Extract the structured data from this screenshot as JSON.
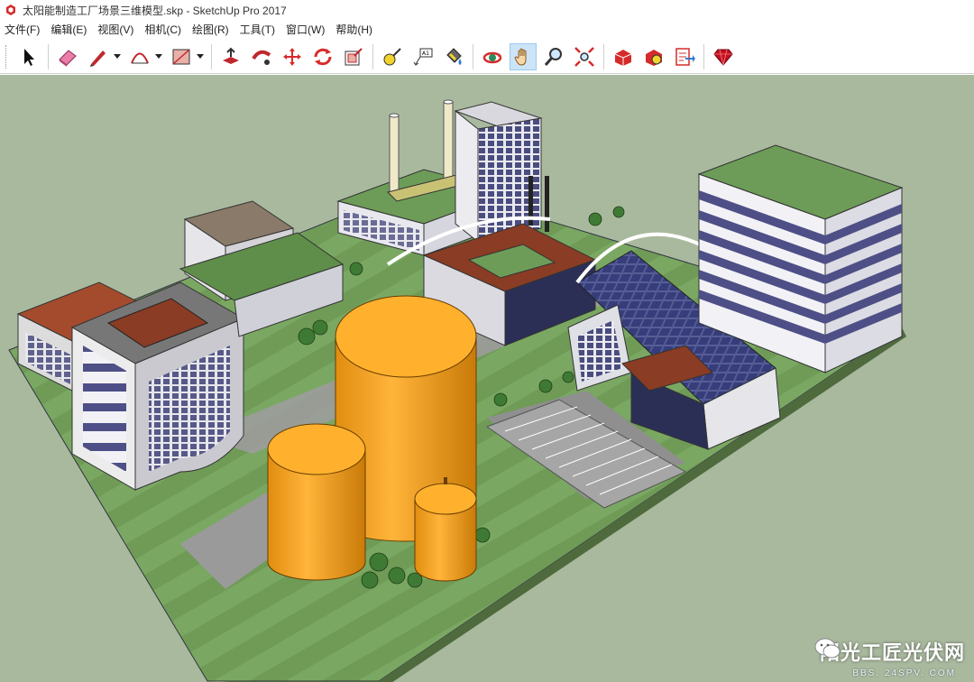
{
  "window": {
    "title": "太阳能制造工厂场景三维模型.skp - SketchUp Pro 2017",
    "app_icon": "sketchup-icon"
  },
  "menu": [
    {
      "label": "文件(F)"
    },
    {
      "label": "编辑(E)"
    },
    {
      "label": "视图(V)"
    },
    {
      "label": "相机(C)"
    },
    {
      "label": "绘图(R)"
    },
    {
      "label": "工具(T)"
    },
    {
      "label": "窗口(W)"
    },
    {
      "label": "帮助(H)"
    }
  ],
  "toolbar": {
    "tools": [
      {
        "icon": "select-arrow-icon"
      },
      {
        "icon": "eraser-icon"
      },
      {
        "icon": "pencil-line-icon",
        "dropdown": true
      },
      {
        "icon": "arc-icon",
        "dropdown": true
      },
      {
        "icon": "rectangle-icon",
        "dropdown": true
      },
      {
        "icon": "push-pull-icon"
      },
      {
        "icon": "follow-me-icon"
      },
      {
        "icon": "move-icon"
      },
      {
        "icon": "rotate-icon"
      },
      {
        "icon": "offset-icon"
      },
      {
        "icon": "tape-measure-icon"
      },
      {
        "icon": "text-label-icon"
      },
      {
        "icon": "paint-bucket-icon"
      },
      {
        "icon": "orbit-icon"
      },
      {
        "icon": "pan-hand-icon",
        "active": true
      },
      {
        "icon": "zoom-icon"
      },
      {
        "icon": "zoom-extents-icon"
      },
      {
        "icon": "warehouse-icon"
      },
      {
        "icon": "extension-warehouse-icon"
      },
      {
        "icon": "send-to-layout-icon"
      },
      {
        "icon": "ruby-extension-icon"
      }
    ]
  },
  "viewport": {
    "background": "#a9b99e",
    "ground": "#6f9b57",
    "tank_color": "#f5a623"
  },
  "watermark": {
    "text": "阳光工匠光伏网",
    "sub": "BBS. 24SPV. COM"
  }
}
